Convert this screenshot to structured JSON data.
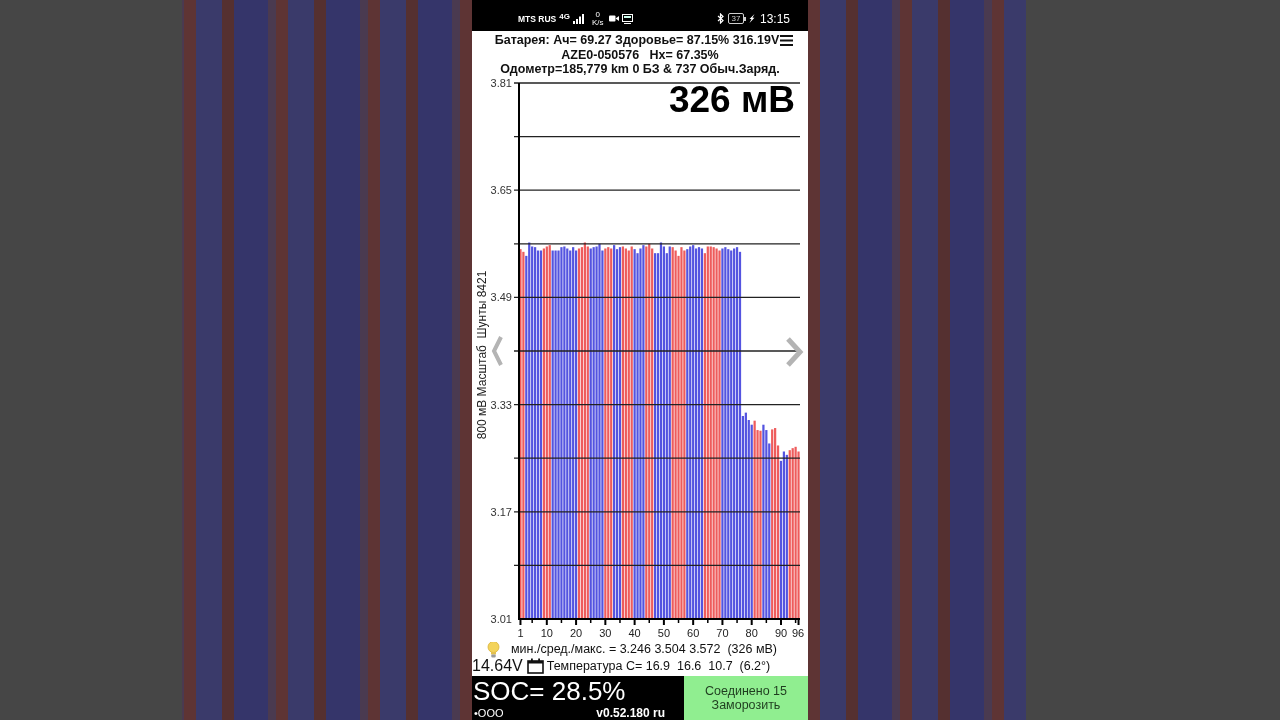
{
  "status_bar": {
    "carrier": "MTS RUS",
    "network": "4G",
    "speed_value": "0",
    "speed_unit": "K/s",
    "battery": "37",
    "time": "13:15"
  },
  "header": {
    "lines": [
      "Батарея: Ач= 69.27 Здоровье= 87.15% 316.19V",
      "AZE0-050576   Hx= 67.35%",
      "Одометр=185,779 km 0 БЗ & 737 Обыч.Заряд."
    ]
  },
  "chart": {
    "reading": "326 мВ",
    "chart_data": {
      "type": "bar",
      "ylabel": "800 мВ Масштаб  Шунты 8421",
      "x": [
        1,
        2,
        3,
        4,
        5,
        6,
        7,
        8,
        9,
        10,
        11,
        12,
        13,
        14,
        15,
        16,
        17,
        18,
        19,
        20,
        21,
        22,
        23,
        24,
        25,
        26,
        27,
        28,
        29,
        30,
        31,
        32,
        33,
        34,
        35,
        36,
        37,
        38,
        39,
        40,
        41,
        42,
        43,
        44,
        45,
        46,
        47,
        48,
        49,
        50,
        51,
        52,
        53,
        54,
        55,
        56,
        57,
        58,
        59,
        60,
        61,
        62,
        63,
        64,
        65,
        66,
        67,
        68,
        69,
        70,
        71,
        72,
        73,
        74,
        75,
        76,
        77,
        78,
        79,
        80,
        81,
        82,
        83,
        84,
        85,
        86,
        87,
        88,
        89,
        90,
        91,
        92,
        93,
        94,
        95,
        96
      ],
      "values": [
        3.562,
        3.558,
        3.552,
        3.572,
        3.566,
        3.565,
        3.56,
        3.56,
        3.563,
        3.566,
        3.568,
        3.56,
        3.56,
        3.56,
        3.565,
        3.566,
        3.563,
        3.56,
        3.565,
        3.56,
        3.563,
        3.565,
        3.572,
        3.566,
        3.563,
        3.565,
        3.566,
        3.57,
        3.56,
        3.563,
        3.565,
        3.563,
        3.568,
        3.562,
        3.565,
        3.566,
        3.563,
        3.56,
        3.566,
        3.562,
        3.556,
        3.563,
        3.568,
        3.566,
        3.57,
        3.563,
        3.556,
        3.556,
        3.572,
        3.566,
        3.556,
        3.566,
        3.565,
        3.56,
        3.552,
        3.565,
        3.56,
        3.562,
        3.566,
        3.568,
        3.563,
        3.565,
        3.563,
        3.556,
        3.566,
        3.566,
        3.565,
        3.563,
        3.56,
        3.563,
        3.565,
        3.562,
        3.56,
        3.563,
        3.565,
        3.558,
        3.313,
        3.318,
        3.307,
        3.3,
        3.306,
        3.292,
        3.291,
        3.3,
        3.292,
        3.272,
        3.293,
        3.295,
        3.269,
        3.246,
        3.26,
        3.255,
        3.262,
        3.265,
        3.267,
        3.26
      ],
      "colors": [
        "#ee5c5c",
        "#ee5c5c",
        "#5454e0",
        "#5454e0",
        "#5454e0",
        "#5454e0",
        "#5454e0",
        "#5454e0",
        "#ee5c5c",
        "#ee5c5c",
        "#ee5c5c",
        "#5454e0",
        "#5454e0",
        "#5454e0",
        "#5454e0",
        "#5454e0",
        "#5454e0",
        "#5454e0",
        "#5454e0",
        "#5454e0",
        "#ee5c5c",
        "#ee5c5c",
        "#ee5c5c",
        "#ee5c5c",
        "#5454e0",
        "#5454e0",
        "#5454e0",
        "#5454e0",
        "#5454e0",
        "#ee5c5c",
        "#ee5c5c",
        "#ee5c5c",
        "#5454e0",
        "#5454e0",
        "#5454e0",
        "#ee5c5c",
        "#ee5c5c",
        "#ee5c5c",
        "#ee5c5c",
        "#5454e0",
        "#5454e0",
        "#5454e0",
        "#5454e0",
        "#ee5c5c",
        "#ee5c5c",
        "#ee5c5c",
        "#5454e0",
        "#5454e0",
        "#5454e0",
        "#5454e0",
        "#5454e0",
        "#5454e0",
        "#ee5c5c",
        "#ee5c5c",
        "#ee5c5c",
        "#ee5c5c",
        "#ee5c5c",
        "#5454e0",
        "#5454e0",
        "#5454e0",
        "#5454e0",
        "#5454e0",
        "#5454e0",
        "#ee5c5c",
        "#ee5c5c",
        "#ee5c5c",
        "#ee5c5c",
        "#ee5c5c",
        "#ee5c5c",
        "#5454e0",
        "#5454e0",
        "#5454e0",
        "#5454e0",
        "#5454e0",
        "#5454e0",
        "#5454e0",
        "#5454e0",
        "#5454e0",
        "#5454e0",
        "#5454e0",
        "#ee5c5c",
        "#ee5c5c",
        "#ee5c5c",
        "#5454e0",
        "#5454e0",
        "#5454e0",
        "#ee5c5c",
        "#ee5c5c",
        "#ee5c5c",
        "#5454e0",
        "#5454e0",
        "#5454e0",
        "#ee5c5c",
        "#ee5c5c",
        "#ee5c5c",
        "#ee5c5c"
      ],
      "xlim": [
        0.5,
        96.5
      ],
      "ylim": [
        3.01,
        3.81
      ],
      "yticks": [
        3.01,
        3.17,
        3.33,
        3.49,
        3.65,
        3.81
      ],
      "xticks": [
        1,
        10,
        20,
        30,
        40,
        50,
        60,
        70,
        80,
        90,
        96
      ],
      "grid": true
    }
  },
  "stats": {
    "cell_summary": "мин./сред./макс. = 3.246 3.504 3.572  (326 мВ)",
    "voltage": "14.64V",
    "temperature": "Температура С= 16.9  16.6  10.7  (6.2°)"
  },
  "bottom_bar": {
    "soc": "SOC= 28.5%",
    "indicator": "•OOO",
    "version": "v0.52.180 ru",
    "button": {
      "lines": [
        "Соединено 15",
        "Заморозить"
      ]
    }
  }
}
